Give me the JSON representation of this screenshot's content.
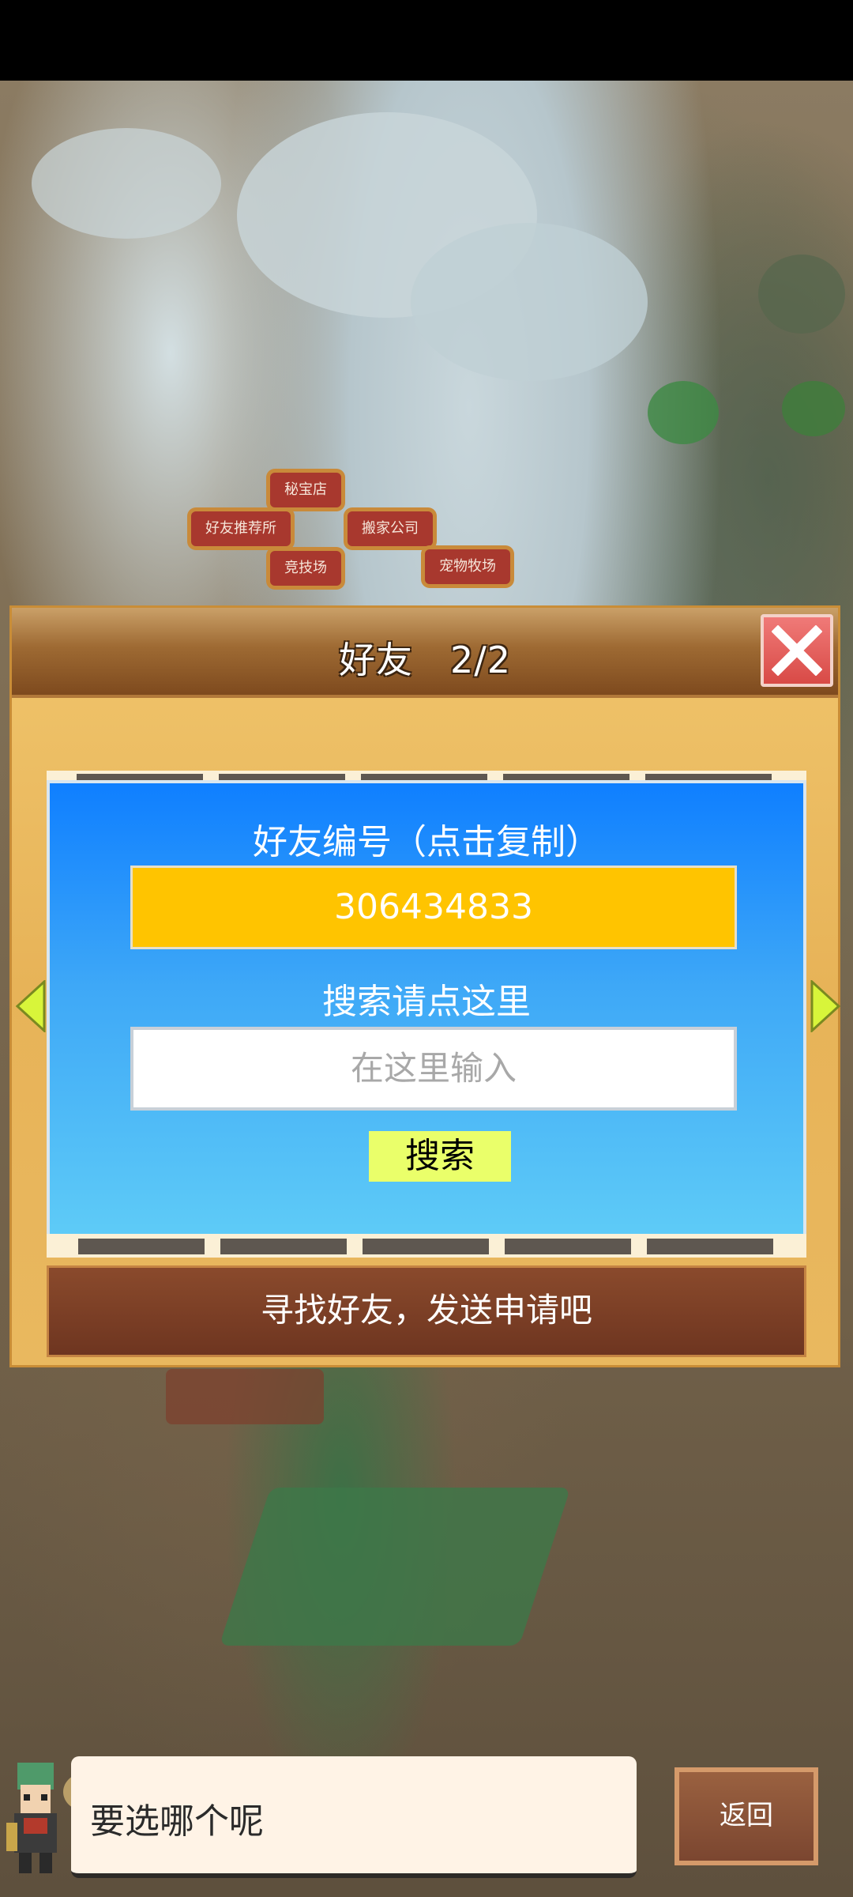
{
  "map": {
    "buildings": [
      {
        "label": "秘宝店"
      },
      {
        "label": "好友推荐所"
      },
      {
        "label": "搬家公司"
      },
      {
        "label": "竞技场"
      },
      {
        "label": "宠物牧场"
      }
    ]
  },
  "dialog": {
    "title": "好友　2/2",
    "friend_id_label": "好友编号（点击复制）",
    "friend_id": "306434833",
    "search_hint": "搜索请点这里",
    "search_placeholder": "在这里输入",
    "search_button": "搜索",
    "find_friends_bar": "寻找好友，发送申请吧"
  },
  "bottom": {
    "message": "要选哪个呢",
    "back_button": "返回"
  },
  "colors": {
    "panel_top": "#0f7fff",
    "id_box": "#ffc400",
    "search_button": "#eaff6a",
    "close_button": "#d84a46"
  }
}
